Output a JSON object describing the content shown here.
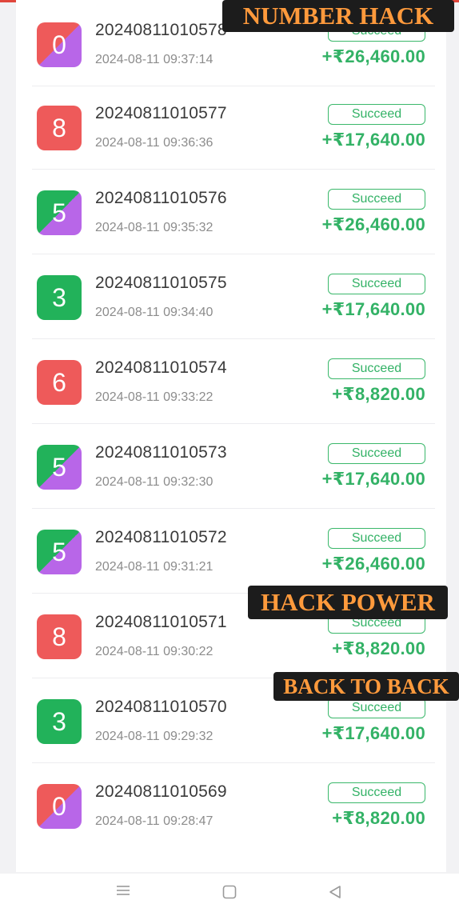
{
  "overlays": {
    "number_hack": "NUMBER HACK",
    "hack_power": "HACK POWER",
    "back_to_back": "BACK TO BACK"
  },
  "colors": {
    "red": "#ee5a5a",
    "green": "#22b25a",
    "violet": "#b866e8",
    "success_green": "#33b266",
    "overlay_text": "#ff9a3c"
  },
  "records": [
    {
      "number": "0",
      "color": "red-violet",
      "period": "20240811010578",
      "time": "2024-08-11 09:37:14",
      "status": "Succeed",
      "amount": "+₹26,460.00"
    },
    {
      "number": "8",
      "color": "red",
      "period": "20240811010577",
      "time": "2024-08-11 09:36:36",
      "status": "Succeed",
      "amount": "+₹17,640.00"
    },
    {
      "number": "5",
      "color": "green-violet",
      "period": "20240811010576",
      "time": "2024-08-11 09:35:32",
      "status": "Succeed",
      "amount": "+₹26,460.00"
    },
    {
      "number": "3",
      "color": "green",
      "period": "20240811010575",
      "time": "2024-08-11 09:34:40",
      "status": "Succeed",
      "amount": "+₹17,640.00"
    },
    {
      "number": "6",
      "color": "red",
      "period": "20240811010574",
      "time": "2024-08-11 09:33:22",
      "status": "Succeed",
      "amount": "+₹8,820.00"
    },
    {
      "number": "5",
      "color": "green-violet",
      "period": "20240811010573",
      "time": "2024-08-11 09:32:30",
      "status": "Succeed",
      "amount": "+₹17,640.00"
    },
    {
      "number": "5",
      "color": "green-violet",
      "period": "20240811010572",
      "time": "2024-08-11 09:31:21",
      "status": "Succeed",
      "amount": "+₹26,460.00"
    },
    {
      "number": "8",
      "color": "red",
      "period": "20240811010571",
      "time": "2024-08-11 09:30:22",
      "status": "Succeed",
      "amount": "+₹8,820.00"
    },
    {
      "number": "3",
      "color": "green",
      "period": "20240811010570",
      "time": "2024-08-11 09:29:32",
      "status": "Succeed",
      "amount": "+₹17,640.00"
    },
    {
      "number": "0",
      "color": "red-violet",
      "period": "20240811010569",
      "time": "2024-08-11 09:28:47",
      "status": "Succeed",
      "amount": "+₹8,820.00"
    }
  ],
  "nav": {
    "menu_icon": "menu-lines-icon",
    "home_icon": "square-home-icon",
    "back_icon": "triangle-back-icon"
  }
}
